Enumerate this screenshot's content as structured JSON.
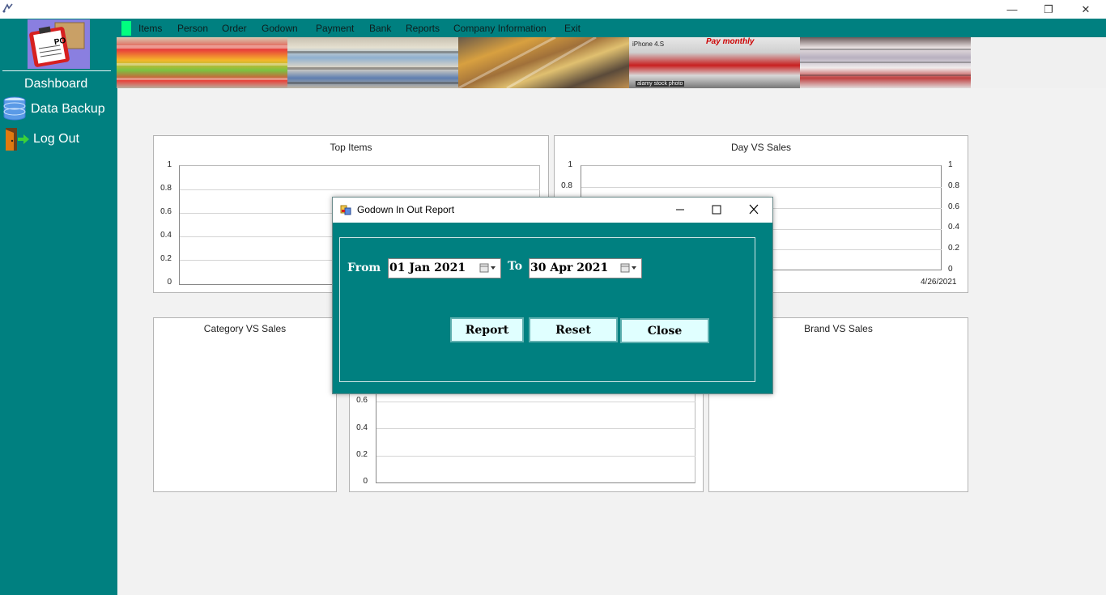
{
  "window": {
    "minimize_glyph": "—",
    "restore_glyph": "❐",
    "close_glyph": "✕"
  },
  "sidebar": {
    "logo_text": "PO",
    "dashboard": "Dashboard",
    "data_backup": "Data Backup",
    "log_out": "Log Out"
  },
  "menu": {
    "items": [
      "Items",
      "Person",
      "Order",
      "Godown",
      "Payment",
      "Bank",
      "Reports",
      "Company Information",
      "Exit"
    ]
  },
  "banner": {
    "tile_4_caption": "Pay monthly",
    "tile_4_small": "iPhone 4.S",
    "tile_4_watermark": "alamy stock photo"
  },
  "charts": {
    "top_items": {
      "title": "Top Items",
      "y_ticks": [
        "1",
        "0.8",
        "0.6",
        "0.4",
        "0.2",
        "0"
      ]
    },
    "day_vs_sales": {
      "title": "Day VS Sales",
      "y_ticks_left": [
        "1",
        "0.8"
      ],
      "y_ticks_right": [
        "1",
        "0.8",
        "0.6",
        "0.4",
        "0.2",
        "0"
      ],
      "x_label": "4/26/2021"
    },
    "category_vs_sales": {
      "title": "Category VS Sales"
    },
    "middle_bottom": {
      "y_ticks": [
        "0.6",
        "0.4",
        "0.2",
        "0"
      ]
    },
    "brand_vs_sales": {
      "title": "Brand VS Sales"
    }
  },
  "dialog": {
    "title": "Godown In Out Report",
    "from_label": "From",
    "from_value": "01  Jan  2021",
    "to_label": "To",
    "to_value": "30  Apr  2021",
    "report_button": "Report",
    "reset_button": "Reset",
    "close_button": "Close"
  }
}
